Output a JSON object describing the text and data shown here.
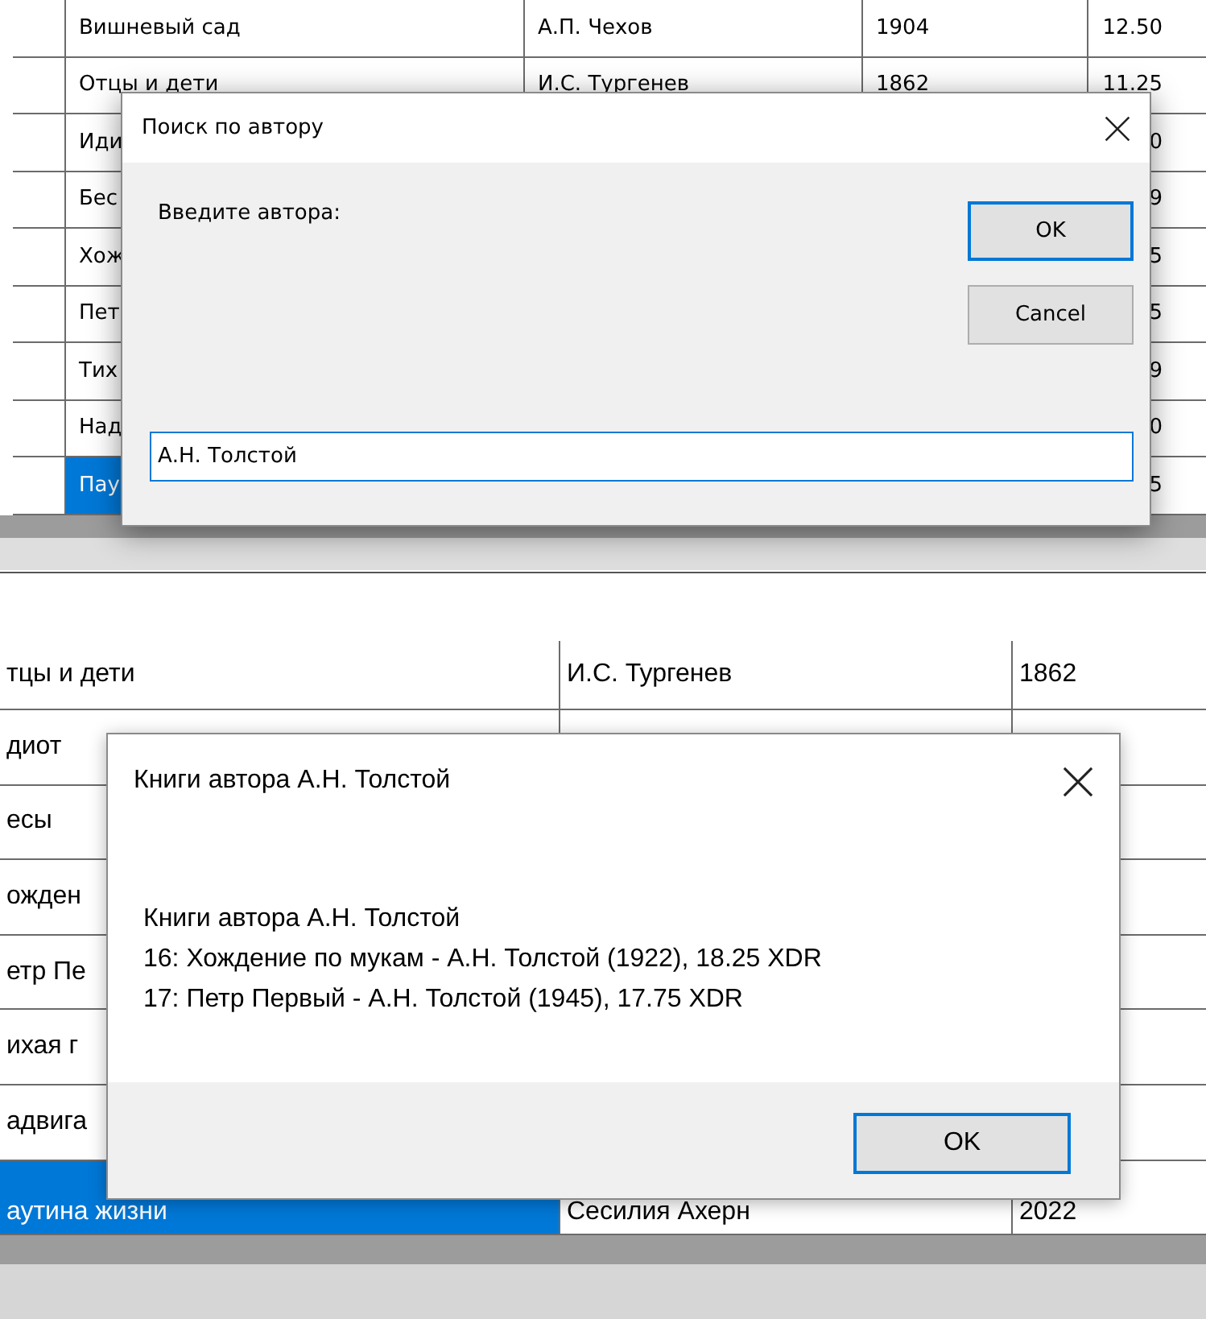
{
  "screens": [
    {
      "table": {
        "rows": [
          {
            "column_1": "Вишневый сад",
            "column_2": "А.П. Чехов",
            "column_3": "1904",
            "column_4": "12.50",
            "selected": false
          },
          {
            "column_1": "Отцы и дети",
            "column_2": "И.С. Тургенев",
            "column_3": "1862",
            "column_4": "11.25",
            "selected": false
          },
          {
            "column_1": "Иди",
            "column_4": "0",
            "selected": false
          },
          {
            "column_1": "Бес",
            "column_4": "9",
            "selected": false
          },
          {
            "column_1": "Хож",
            "column_4": "5",
            "selected": false
          },
          {
            "column_1": "Пет",
            "column_4": "5",
            "selected": false
          },
          {
            "column_1": "Тих",
            "column_4": "9",
            "selected": false
          },
          {
            "column_1": "Над",
            "column_4": "0",
            "selected": false
          },
          {
            "column_1": "Пау",
            "column_4": "5",
            "selected": true
          }
        ]
      },
      "dialog": {
        "kind": "input",
        "title": "Поиск по автору",
        "prompt": "Введите автора:",
        "input": {
          "value": "А.Н. Толстой"
        },
        "buttons": [
          {
            "label": "OK",
            "default": true
          },
          {
            "label": "Cancel",
            "default": false
          }
        ]
      }
    },
    {
      "table": {
        "rows": [
          {
            "column_1": "тцы и дети",
            "column_2": "И.С. Тургенев",
            "column_3": "1862",
            "selected": false
          },
          {
            "column_1": "диот",
            "selected": false
          },
          {
            "column_1": "есы",
            "selected": false
          },
          {
            "column_1": "ожден",
            "selected": false
          },
          {
            "column_1": "етр Пе",
            "selected": false
          },
          {
            "column_1": "ихая г",
            "selected": false
          },
          {
            "column_1": "адвига",
            "selected": false
          },
          {
            "column_1": "аутина жизни",
            "column_2": "Сесилия Ахерн",
            "column_3": "2022",
            "selected": true
          }
        ]
      },
      "dialog": {
        "kind": "message",
        "title": "Книги автора А.Н. Толстой",
        "message_lines": [
          "Книги автора А.Н. Толстой",
          "16: Хождение по мукам - А.Н. Толстой (1922), 18.25 XDR",
          "17: Петр Первый - А.Н. Толстой (1945), 17.75 XDR"
        ],
        "buttons": [
          {
            "label": "OK",
            "default": true
          }
        ]
      }
    }
  ]
}
